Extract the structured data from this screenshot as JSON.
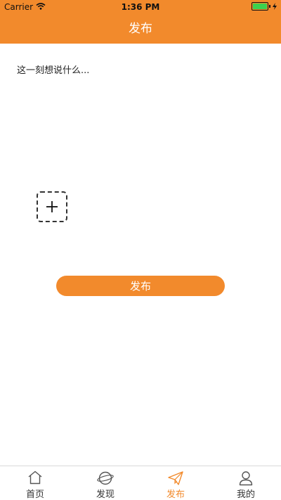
{
  "status_bar": {
    "carrier": "Carrier",
    "time": "1:36 PM",
    "battery_color": "#3bd14e"
  },
  "header": {
    "title": "发布",
    "background": "#f28a2c"
  },
  "compose": {
    "placeholder": "这一刻想说什么...",
    "add_image_icon": "plus-icon",
    "publish_label": "发布"
  },
  "tabbar": {
    "active_color": "#f28a2c",
    "items": [
      {
        "label": "首页",
        "icon": "home-icon"
      },
      {
        "label": "发现",
        "icon": "planet-icon"
      },
      {
        "label": "发布",
        "icon": "paper-plane-icon",
        "active": true
      },
      {
        "label": "我的",
        "icon": "user-icon"
      }
    ]
  }
}
